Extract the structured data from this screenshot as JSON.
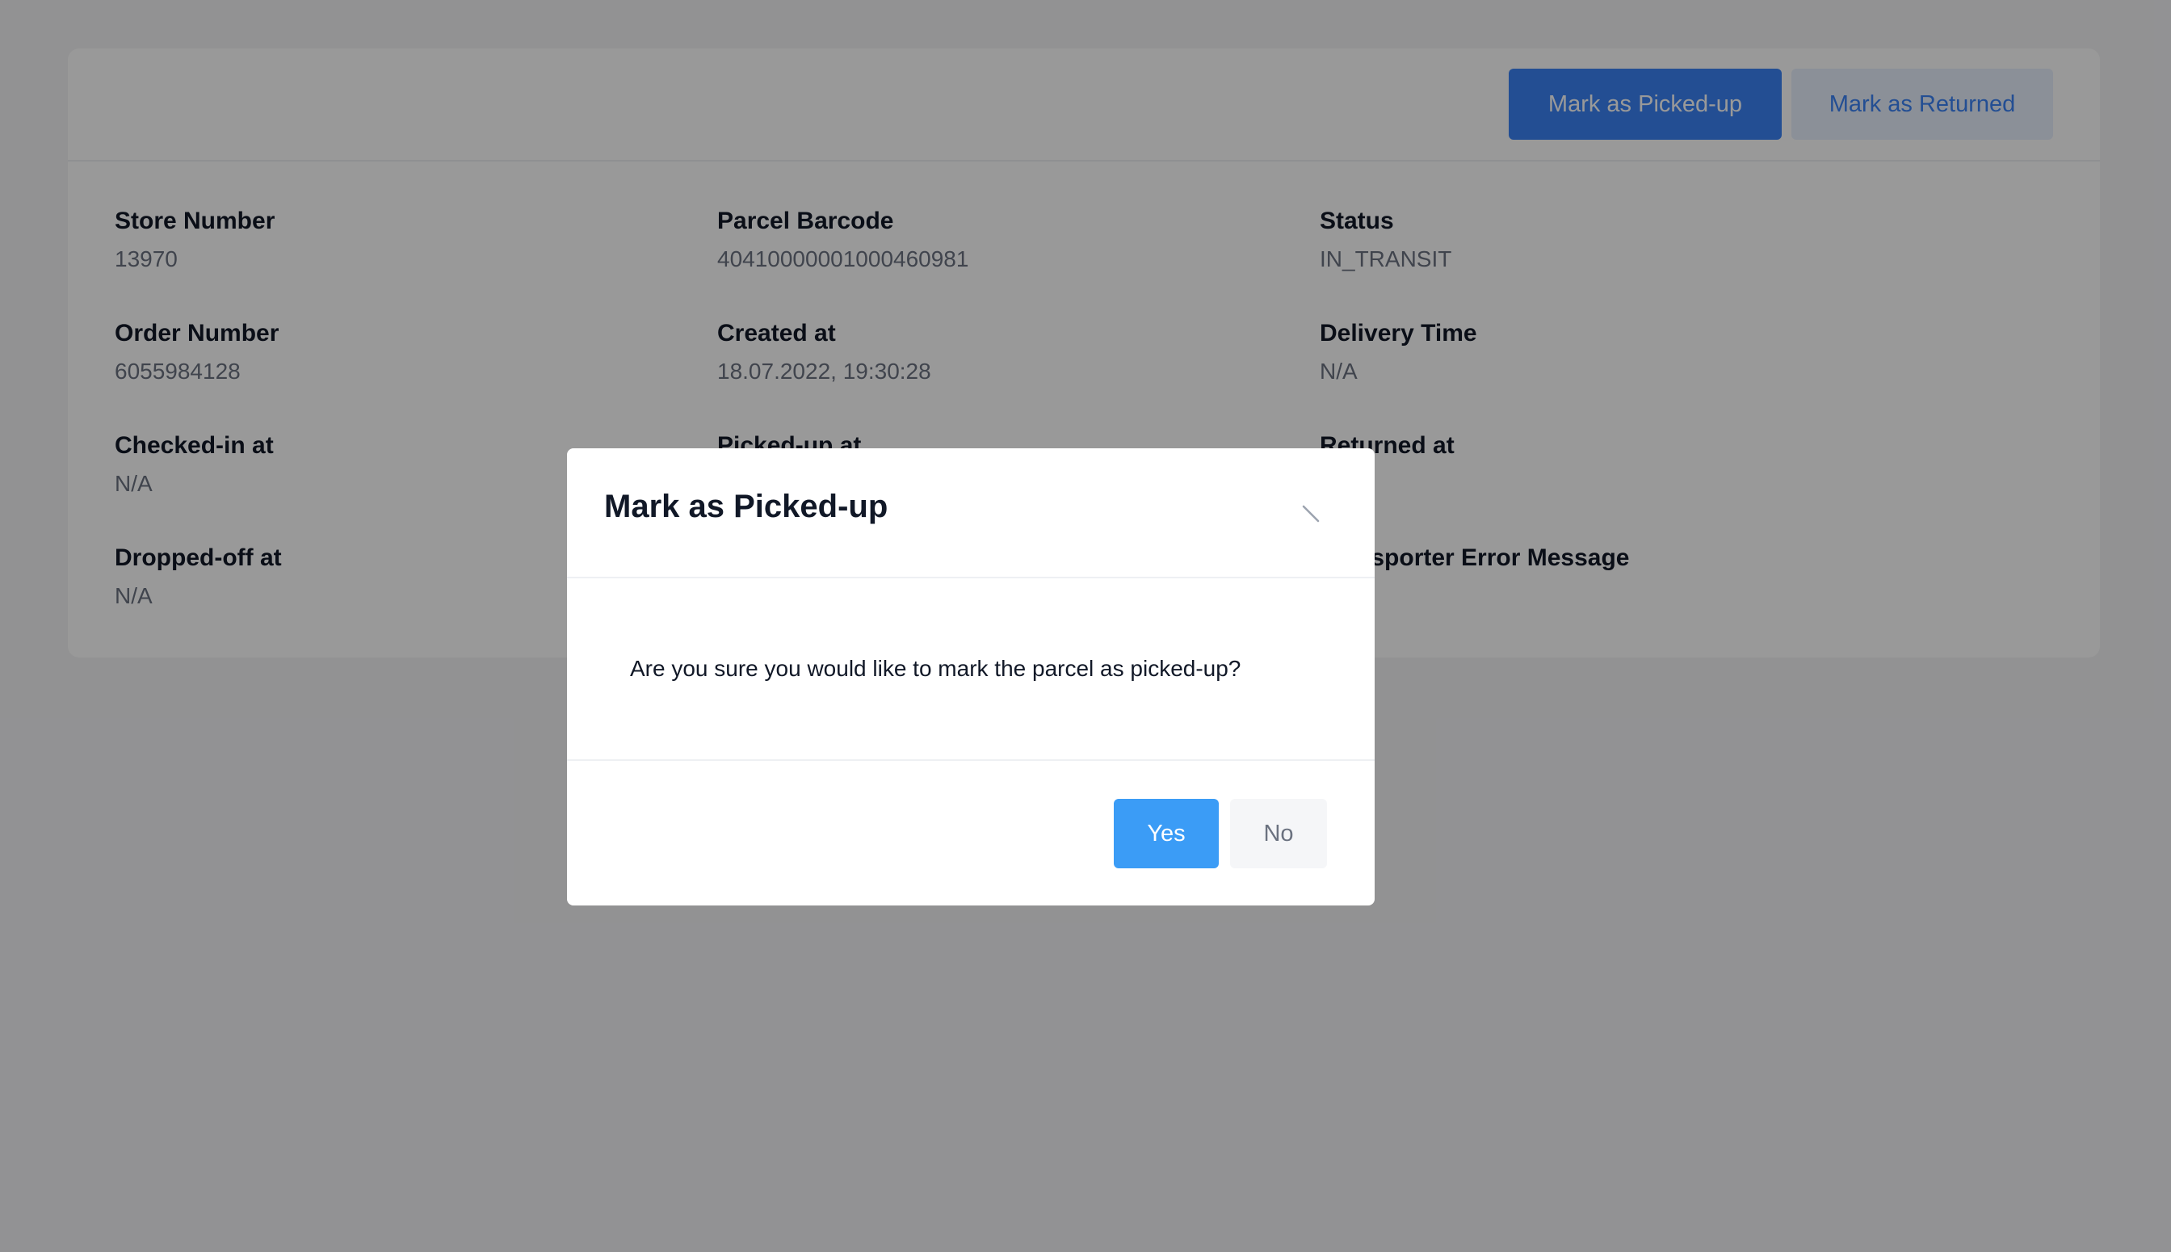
{
  "header": {
    "mark_picked_up_label": "Mark as Picked-up",
    "mark_returned_label": "Mark as Returned"
  },
  "details": {
    "store_number": {
      "label": "Store Number",
      "value": "13970"
    },
    "parcel_barcode": {
      "label": "Parcel Barcode",
      "value": "40410000001000460981"
    },
    "status": {
      "label": "Status",
      "value": "IN_TRANSIT"
    },
    "order_number": {
      "label": "Order Number",
      "value": "6055984128"
    },
    "created_at": {
      "label": "Created at",
      "value": "18.07.2022, 19:30:28"
    },
    "delivery_time": {
      "label": "Delivery Time",
      "value": "N/A"
    },
    "checked_in_at": {
      "label": "Checked-in at",
      "value": "N/A"
    },
    "picked_up_at": {
      "label": "Picked-up at",
      "value": ""
    },
    "returned_at": {
      "label": "Returned at",
      "value": ""
    },
    "dropped_off_at": {
      "label": "Dropped-off at",
      "value": "N/A"
    },
    "transporter_error_message": {
      "label": "Transporter Error Message",
      "value": ""
    }
  },
  "modal": {
    "title": "Mark as Picked-up",
    "message": "Are you sure you would like to mark the parcel as picked-up?",
    "yes_label": "Yes",
    "no_label": "No",
    "close_icon": "close-icon"
  },
  "colors": {
    "primary": "#3b82f6",
    "primary_light": "#e8f1fd",
    "overlay": "rgba(0,0,0,0.40)",
    "label_text": "#111827",
    "value_text": "#6b7280"
  }
}
